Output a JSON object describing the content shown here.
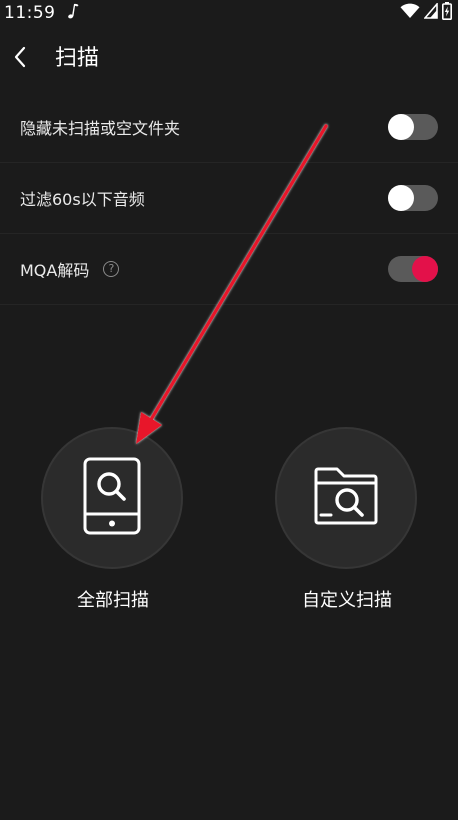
{
  "status_bar": {
    "time": "11:59"
  },
  "header": {
    "title": "扫描"
  },
  "settings": [
    {
      "label": "隐藏未扫描或空文件夹",
      "enabled": false,
      "has_help": false
    },
    {
      "label": "过滤60s以下音频",
      "enabled": false,
      "has_help": false
    },
    {
      "label": "MQA解码",
      "enabled": true,
      "has_help": true
    }
  ],
  "help_glyph": "?",
  "scan_options": {
    "all_label": "全部扫描",
    "custom_label": "自定义扫描"
  },
  "colors": {
    "background": "#1b1b1b",
    "toggle_on": "#e3114a",
    "toggle_track": "#5a5a5a",
    "annotation_arrow": "#e8132b"
  },
  "icons": {
    "back": "chevron-left-icon",
    "scan_all": "phone-search-icon",
    "scan_custom": "folder-search-icon"
  }
}
